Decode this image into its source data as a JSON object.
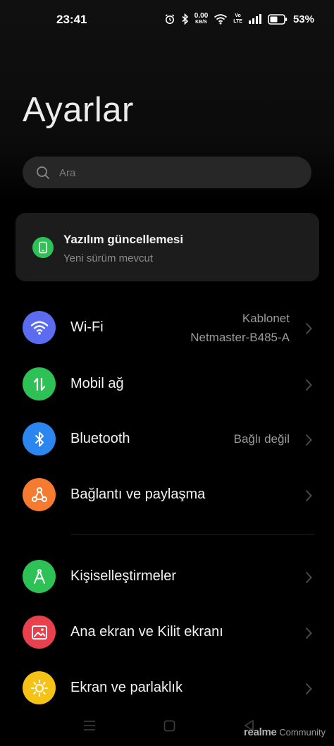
{
  "status_bar": {
    "time": "23:41",
    "net_speed_value": "0.00",
    "net_speed_unit": "KB/S",
    "volte_top": "Vo",
    "volte_bottom": "LTE",
    "battery_percent": "53%"
  },
  "header": {
    "title": "Ayarlar"
  },
  "search": {
    "placeholder": "Ara"
  },
  "update_card": {
    "title": "Yazılım güncellemesi",
    "subtitle": "Yeni sürüm mevcut"
  },
  "settings": {
    "items": [
      {
        "label": "Wi-Fi",
        "value_line1": "Kablonet",
        "value_line2": "Netmaster-B485-A",
        "icon": "wifi-icon",
        "color": "#5b6cf0"
      },
      {
        "label": "Mobil ağ",
        "value": "",
        "icon": "mobile-data-icon",
        "color": "#2ec256"
      },
      {
        "label": "Bluetooth",
        "value": "Bağlı değil",
        "icon": "bluetooth-icon",
        "color": "#2c86f0"
      },
      {
        "label": "Bağlantı ve paylaşma",
        "value": "",
        "icon": "share-icon",
        "color": "#f57b31"
      },
      {
        "label": "Kişiselleştirmeler",
        "value": "",
        "icon": "personalization-icon",
        "color": "#2ec256"
      },
      {
        "label": "Ana ekran ve Kilit ekranı",
        "value": "",
        "icon": "wallpaper-icon",
        "color": "#e8414d"
      },
      {
        "label": "Ekran ve parlaklık",
        "value": "",
        "icon": "brightness-icon",
        "color": "#f5c215"
      }
    ]
  },
  "watermark": {
    "brand": "realme",
    "suffix": "Community"
  },
  "colors": {
    "background": "#000000",
    "card": "#1c1c1c",
    "search": "#272727",
    "secondary_text": "#9a9a9a"
  }
}
